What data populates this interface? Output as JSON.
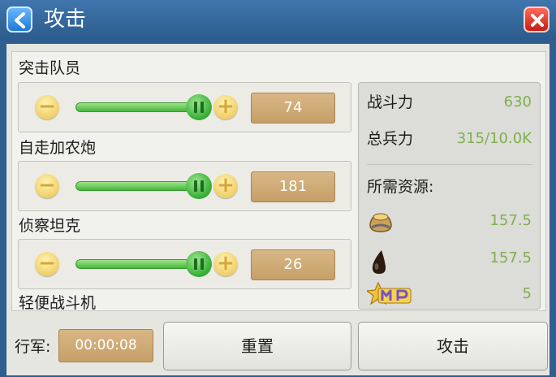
{
  "window": {
    "title": "攻击"
  },
  "units": [
    {
      "label": "突击队员",
      "value": "74"
    },
    {
      "label": "自走加农炮",
      "value": "181"
    },
    {
      "label": "侦察坦克",
      "value": "26"
    },
    {
      "label": "轻便战斗机"
    }
  ],
  "stats": {
    "power_label": "战斗力",
    "power_value": "630",
    "troops_label": "总兵力",
    "troops_value": "315/10.0K",
    "resources_label": "所需资源:",
    "resources": [
      {
        "icon": "food-sack-icon",
        "value": "157.5"
      },
      {
        "icon": "oil-drop-icon",
        "value": "157.5"
      },
      {
        "icon": "mp-icon",
        "value": "5"
      }
    ]
  },
  "footer": {
    "march_label": "行军:",
    "march_time": "00:00:08",
    "reset_label": "重置",
    "attack_label": "攻击"
  },
  "colors": {
    "title_bar": "#2c5b8c",
    "stat_value": "#7fb04f",
    "value_box": "#c69f68"
  }
}
